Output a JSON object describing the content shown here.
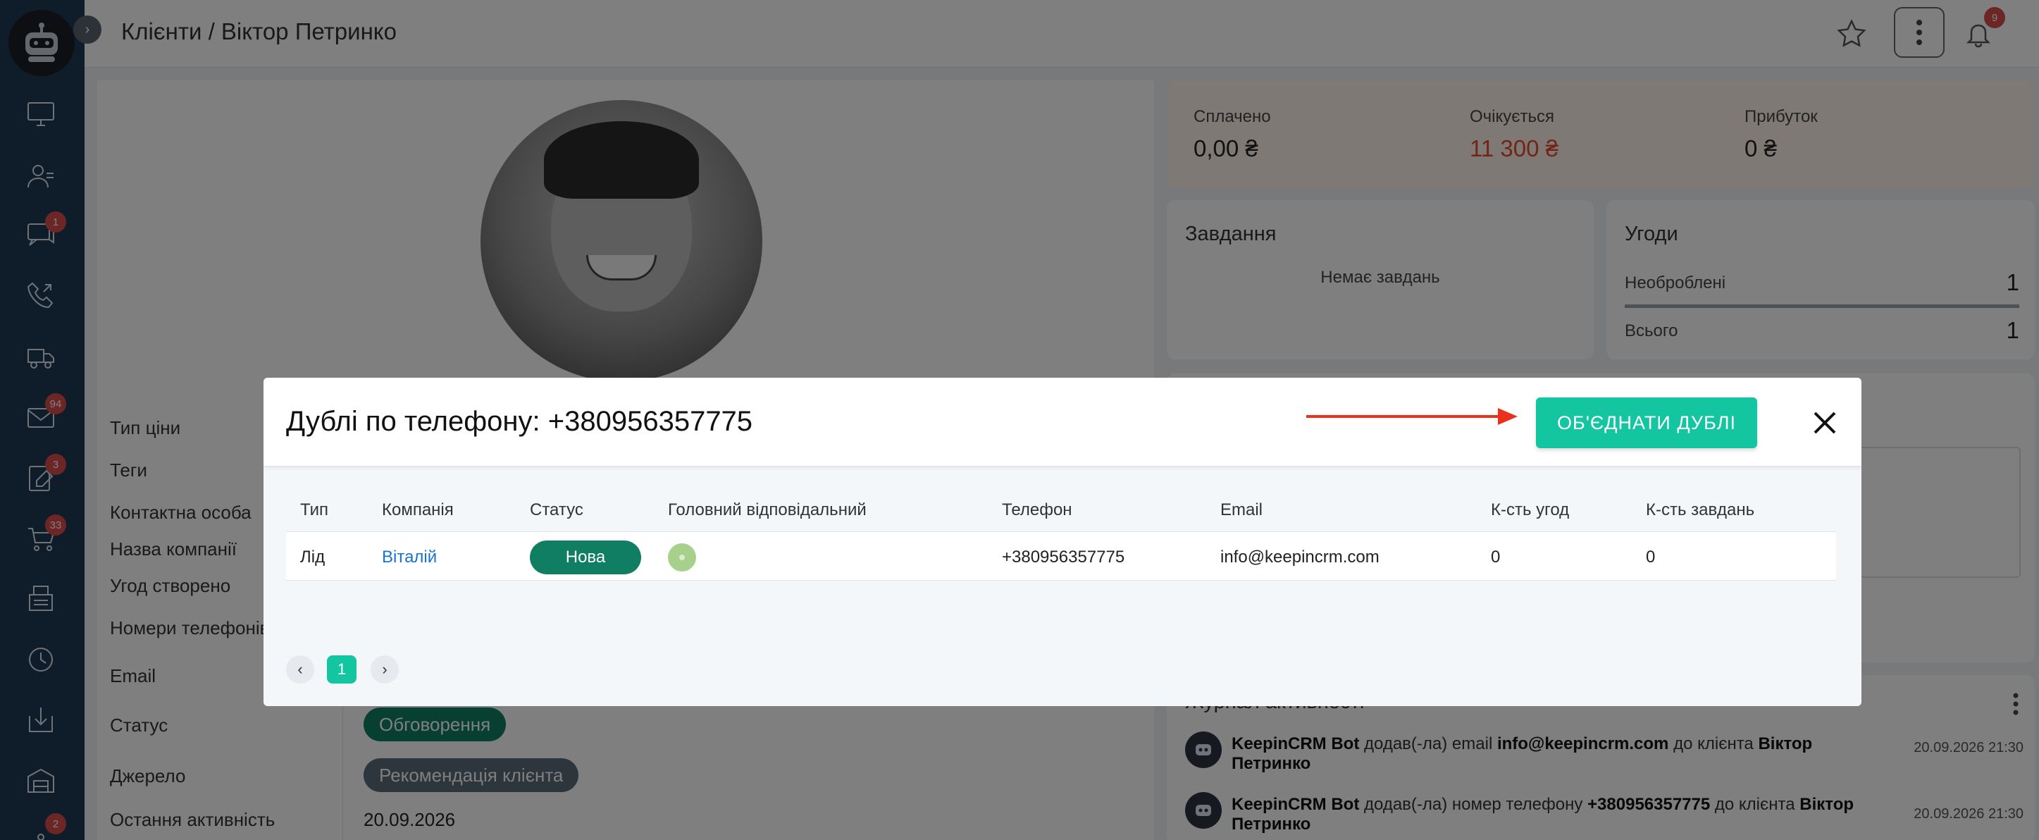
{
  "header": {
    "title": "Клієнти / Віктор Петринко",
    "notifications_count": "9"
  },
  "sidebar": {
    "items": [
      {
        "icon": "desktop-icon",
        "badge": ""
      },
      {
        "icon": "users-icon",
        "badge": ""
      },
      {
        "icon": "chat-icon",
        "badge": "1"
      },
      {
        "icon": "phone-icon",
        "badge": ""
      },
      {
        "icon": "truck-icon",
        "badge": ""
      },
      {
        "icon": "mail-icon",
        "badge": "94"
      },
      {
        "icon": "edit-icon",
        "badge": "3"
      },
      {
        "icon": "cart-icon",
        "badge": "33"
      },
      {
        "icon": "register-icon",
        "badge": ""
      },
      {
        "icon": "history-icon",
        "badge": ""
      },
      {
        "icon": "download-icon",
        "badge": ""
      },
      {
        "icon": "warehouse-icon",
        "badge": ""
      },
      {
        "icon": "more-icon",
        "badge": "2"
      }
    ]
  },
  "profile": {
    "fields": {
      "price_type": "Тип ціни",
      "tags": "Теги",
      "contact_person": "Контактна особа",
      "company_name": "Назва компанії",
      "deals_created": "Угод створено",
      "phone_numbers": "Номери телефонів",
      "email": "Email",
      "status": "Статус",
      "source": "Джерело",
      "last_activity": "Остання активність"
    },
    "status_value": "Обговорення",
    "source_value": "Рекомендація клієнта",
    "last_activity_value": "20.09.2026"
  },
  "stats": {
    "paid_label": "Сплачено",
    "paid_value": "0,00 ₴",
    "expected_label": "Очікується",
    "expected_value": "11 300 ₴",
    "profit_label": "Прибуток",
    "profit_value": "0 ₴"
  },
  "tasks": {
    "title": "Завдання",
    "empty": "Немає завдань"
  },
  "deals": {
    "title": "Угоди",
    "unprocessed_label": "Необроблені",
    "unprocessed_value": "1",
    "total_label": "Всього",
    "total_value": "1"
  },
  "activity": {
    "title": "Журнал активності",
    "items": [
      {
        "actor": "KeepinCRM Bot",
        "action": " додав(-ла) email ",
        "object": "info@keepincrm.com",
        "mid": " до клієнта ",
        "target": "Віктор Петринко",
        "time": "20.09.2026 21:30"
      },
      {
        "actor": "KeepinCRM Bot",
        "action": " додав(-ла) номер телефону ",
        "object": "+380956357775",
        "mid": " до клієнта ",
        "target": "Віктор Петринко",
        "time": "20.09.2026 21:30"
      }
    ]
  },
  "modal": {
    "title": "Дублі по телефону: +380956357775",
    "merge_button": "ОБ'ЄДНАТИ ДУБЛІ",
    "columns": [
      "Тип",
      "Компанія",
      "Статус",
      "Головний відповідальний",
      "Телефон",
      "Email",
      "К-сть угод",
      "К-сть завдань"
    ],
    "rows": [
      {
        "type": "Лід",
        "company": "Віталій",
        "status": "Нова",
        "responsible": "",
        "phone": "+380956357775",
        "email": "info@keepincrm.com",
        "deals_count": "0",
        "tasks_count": "0"
      }
    ],
    "pagination": {
      "prev": "‹",
      "current": "1",
      "next": "›"
    }
  },
  "colors": {
    "accent": "#13c5a0",
    "sidebar": "#1f3a57",
    "status_new": "#0f7e63",
    "expected": "#e8472e",
    "link": "#1a73c9"
  }
}
